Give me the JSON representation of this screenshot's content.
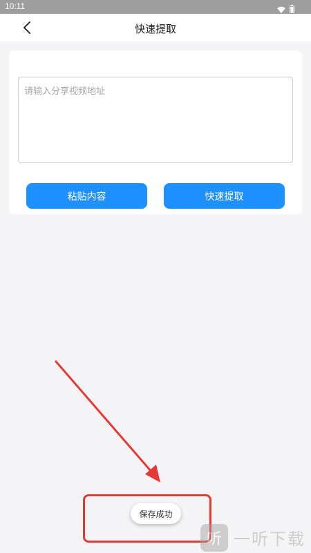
{
  "status_bar": {
    "time": "10:11",
    "icons": [
      "wifi-icon",
      "battery-icon"
    ]
  },
  "header": {
    "title": "快速提取",
    "back_icon": "chevron-left-icon"
  },
  "form": {
    "url_placeholder": "请输入分享视频地址",
    "url_value": ""
  },
  "buttons": {
    "paste_label": "粘贴内容",
    "extract_label": "快速提取"
  },
  "toast": {
    "message": "保存成功"
  },
  "annotation": {
    "color": "#e53935"
  },
  "watermark": {
    "logo_glyph": "听",
    "text": "一听下载"
  },
  "colors": {
    "accent": "#1e90ff",
    "background": "#f5f5f7",
    "status_bar": "#9e9e9e"
  }
}
